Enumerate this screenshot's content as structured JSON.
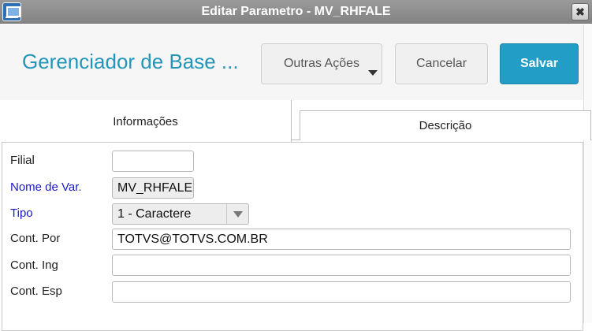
{
  "window": {
    "title": "Editar Parametro - MV_RHFALE",
    "close_glyph": "✖"
  },
  "header": {
    "title": "Gerenciador de Base ...",
    "more_label": "Outras Ações",
    "cancel_label": "Cancelar",
    "save_label": "Salvar"
  },
  "tabs": [
    {
      "label": "Informações",
      "active": true
    },
    {
      "label": "Descrição",
      "active": false
    }
  ],
  "form": {
    "filial": {
      "label": "Filial",
      "value": ""
    },
    "nome_var": {
      "label": "Nome de Var.",
      "value": "MV_RHFALE"
    },
    "tipo": {
      "label": "Tipo",
      "value": "1 - Caractere"
    },
    "cont_por": {
      "label": "Cont. Por",
      "value": "TOTVS@TOTVS.COM.BR"
    },
    "cont_ing": {
      "label": "Cont. Ing",
      "value": ""
    },
    "cont_esp": {
      "label": "Cont. Esp",
      "value": ""
    }
  },
  "colors": {
    "accent": "#229dc5",
    "title_text": "#2494b8",
    "required_label": "#1a1ac9"
  },
  "icons": [
    "app-window-icon",
    "close-icon",
    "chevron-down-icon",
    "dropdown-arrow-icon"
  ]
}
